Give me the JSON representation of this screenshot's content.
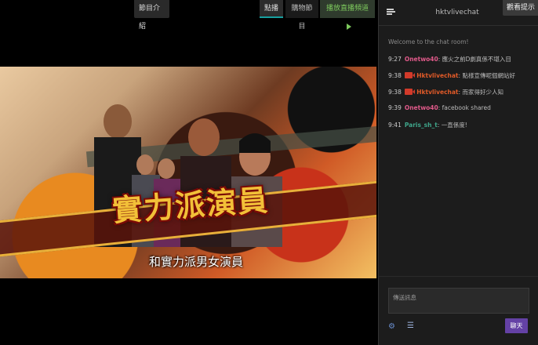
{
  "player": {
    "program_button": "節目介紹",
    "tabs": [
      {
        "label": "點播",
        "active": true
      },
      {
        "label": "購物節目",
        "active": false
      },
      {
        "label": "播放直播頻道",
        "active": false
      }
    ],
    "video": {
      "headline": "實力派演員",
      "subtitle": "和實力派男女演員"
    }
  },
  "chat": {
    "title": "hktvlivechat",
    "viewer_tip": "觀看提示",
    "welcome": "Welcome to the chat room!",
    "messages": [
      {
        "time": "9:27",
        "user": "Onetwo40",
        "user_color": "#e05a8a",
        "text": ": 應火之前D劇真係不堪入目",
        "badge": false
      },
      {
        "time": "9:38",
        "user": "Hktvlivechat",
        "user_color": "#e05a28",
        "text": ": 點樣宣傳呢個網站好",
        "badge": true
      },
      {
        "time": "9:38",
        "user": "Hktvlivechat",
        "user_color": "#e05a28",
        "text": ": 而家得好少人知",
        "badge": true
      },
      {
        "time": "9:39",
        "user": "Onetwo40",
        "user_color": "#e05a8a",
        "text": ": facebook shared",
        "badge": false
      },
      {
        "time": "9:41",
        "user": "Paris_sh_t",
        "user_color": "#3fa58a",
        "text": ": 一直係度!",
        "badge": false
      }
    ],
    "input_placeholder": "傳送訊息",
    "send_label": "聊天",
    "icons": {
      "menu": "menu-icon",
      "settings": "gear-icon",
      "list": "list-icon",
      "broadcaster": "camera-icon"
    }
  }
}
